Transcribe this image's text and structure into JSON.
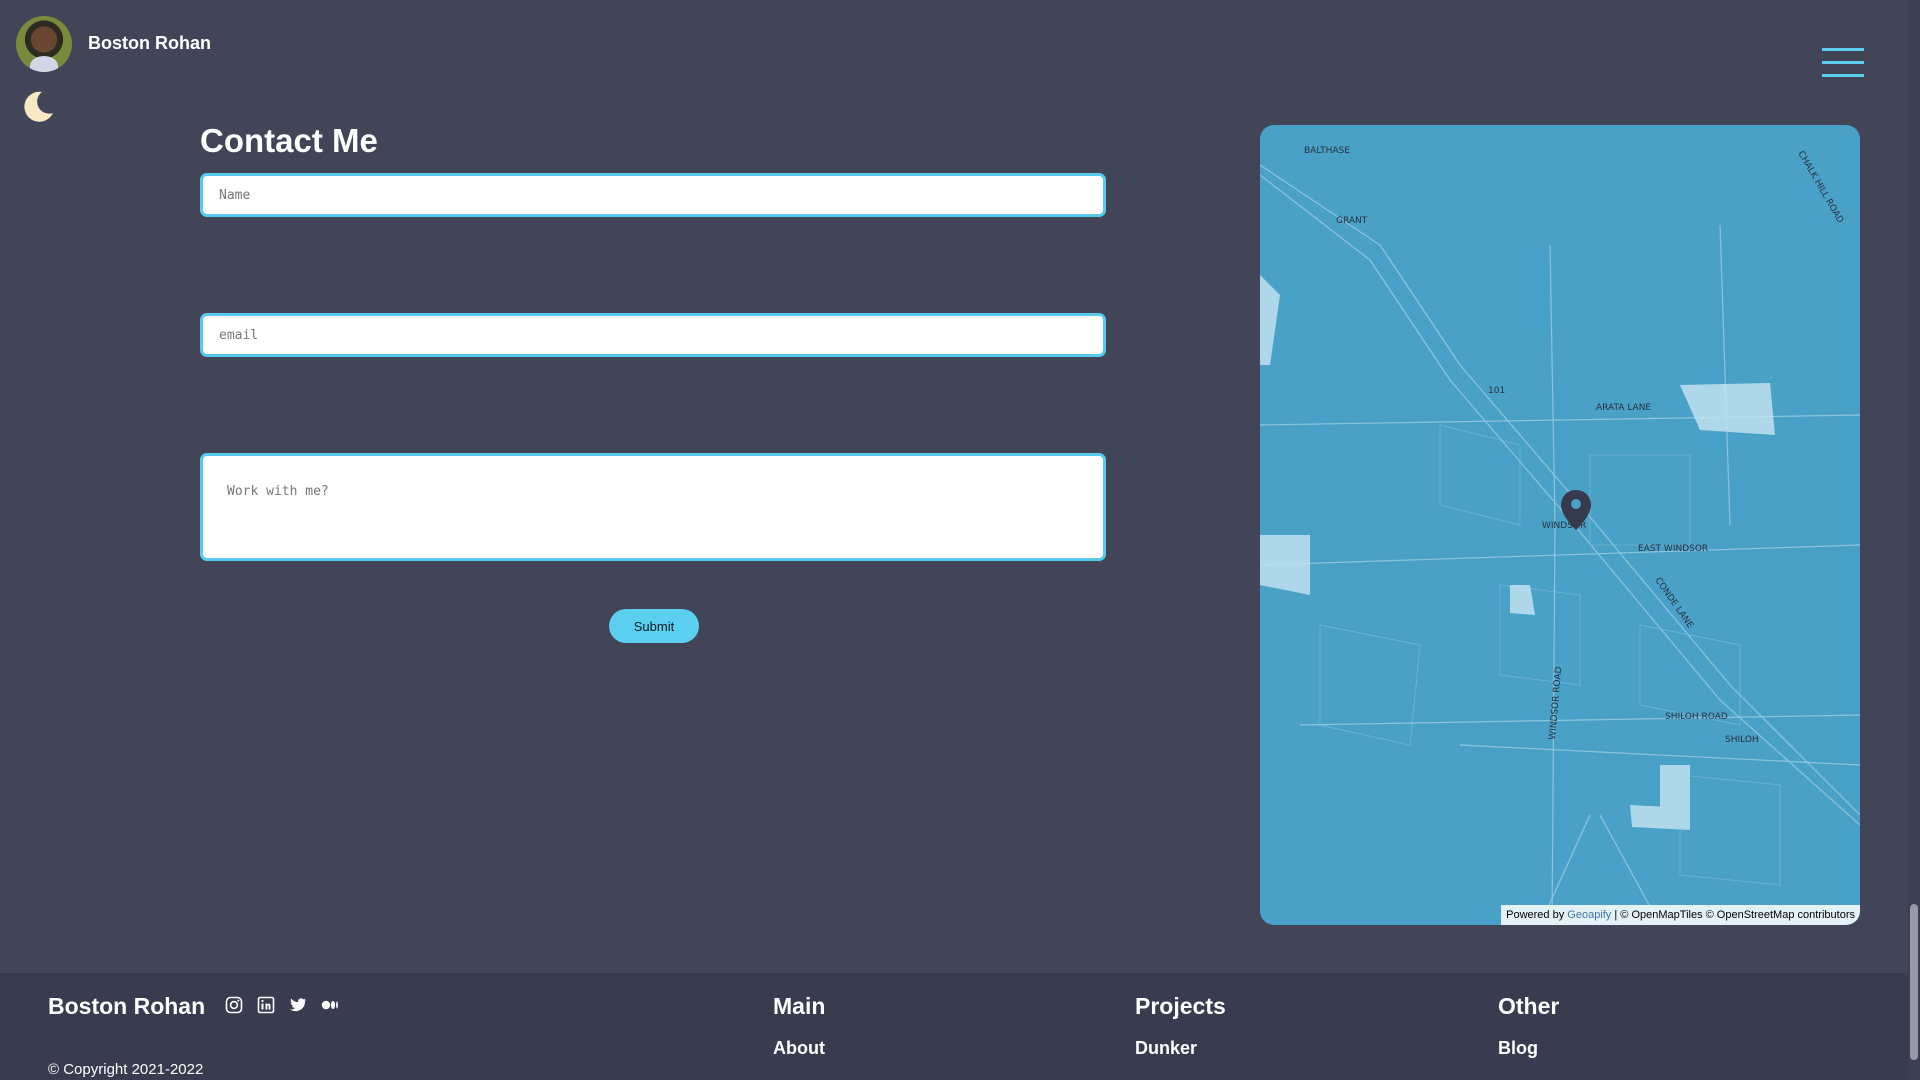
{
  "header": {
    "site_name": "Boston Rohan",
    "avatar": "profile-photo",
    "theme_icon": "moon-icon",
    "menu_icon": "hamburger-menu-icon",
    "accent_color": "#5bcff0"
  },
  "contact": {
    "title": "Contact Me",
    "name_placeholder": "Name",
    "email_placeholder": "email",
    "message_placeholder": "Work with me?",
    "submit_label": "Submit"
  },
  "map": {
    "labels": [
      "BALTHASE",
      "GRANT",
      "101",
      "ARATA LANE",
      "WINDSOR",
      "EAST WINDSOR",
      "CONDE LANE",
      "WINDSOR ROAD",
      "SHILOH ROAD",
      "SHILOH",
      "CHALK HILL ROAD"
    ],
    "attribution_prefix": "Powered by",
    "attribution_geoapify": "Geoapify",
    "attribution_sep": "| © OpenMapTiles © OpenStreetMap",
    "attribution_suffix": "contributors",
    "marker_icon": "map-pin-icon",
    "water_color": "#4aa1c8"
  },
  "footer": {
    "brand": "Boston Rohan",
    "social_icons": [
      "instagram-icon",
      "linkedin-icon",
      "twitter-icon",
      "medium-icon"
    ],
    "copyright": "© Copyright 2021-2022",
    "columns": [
      {
        "heading": "Main",
        "link": "About"
      },
      {
        "heading": "Projects",
        "link": "Dunker"
      },
      {
        "heading": "Other",
        "link": "Blog"
      }
    ]
  }
}
